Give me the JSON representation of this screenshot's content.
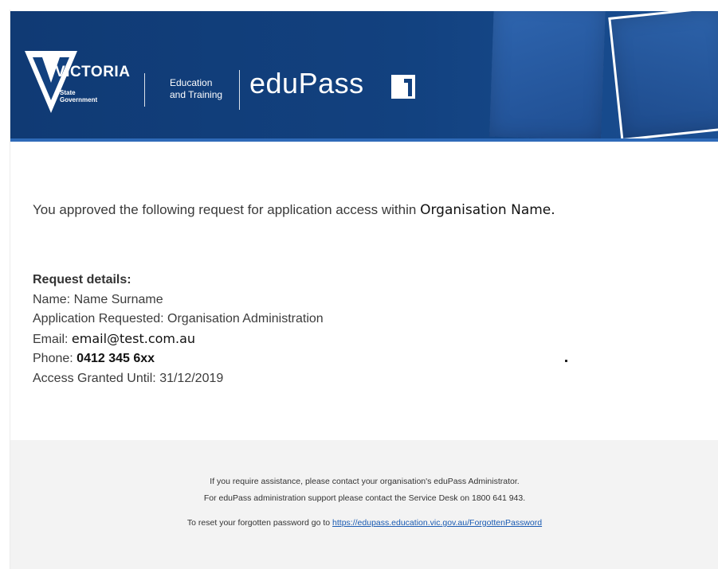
{
  "header": {
    "logo_word": "VICTORIA",
    "logo_sub_line1": "State",
    "logo_sub_line2": "Government",
    "dept_line1": "Education",
    "dept_line2": "and Training",
    "brand": "eduPass",
    "colors": {
      "banner": "#12417f",
      "text": "#ffffff"
    }
  },
  "message": {
    "intro_text": "You approved the following request for application access within",
    "org_name": "Organisation Name."
  },
  "details": {
    "heading": "Request details:",
    "name_label": "Name:",
    "name_value": "Name Surname",
    "app_label": "Application Requested:",
    "app_value": "Organisation Administration",
    "email_label": "Email:",
    "email_value": "email@test.com.au",
    "phone_label": "Phone:",
    "phone_value": "0412 345 6xx",
    "access_label": "Access Granted Until:",
    "access_value": "31/12/2019"
  },
  "footer": {
    "assist_text": "If you require assistance, please contact your organisation's eduPass Administrator.",
    "support_text": "For eduPass administration support please contact the Service Desk on 1800 641 943.",
    "reset_text": "To reset your forgotten password go to",
    "reset_link": "https://edupass.education.vic.gov.au/ForgottenPassword",
    "link_color": "#1a5bb3"
  }
}
